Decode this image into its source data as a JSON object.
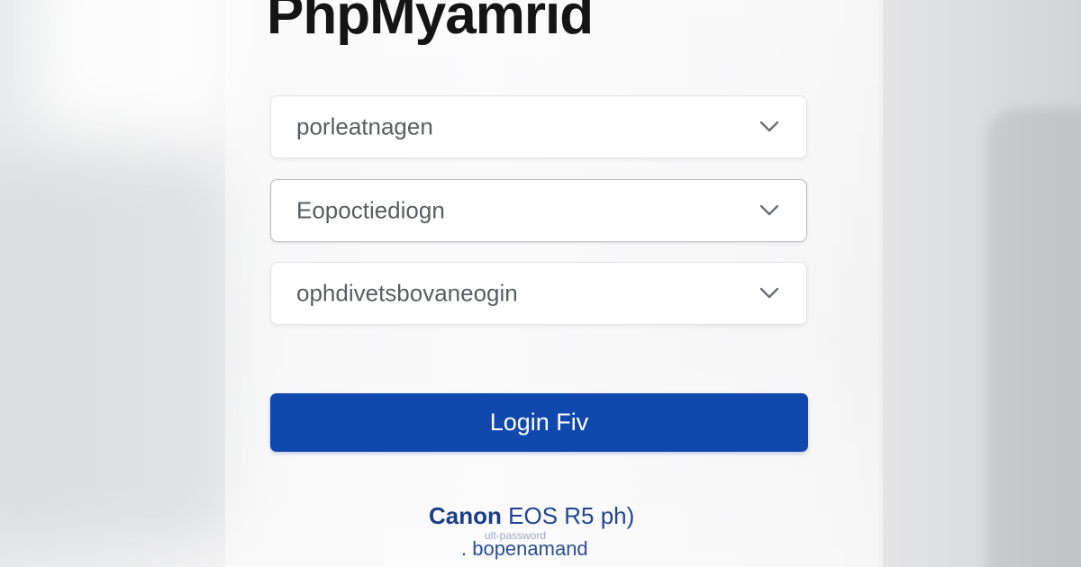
{
  "app": {
    "title": "PhpMyamrid"
  },
  "login_form": {
    "fields": [
      {
        "value": "porleatnagen",
        "icon": "chevron-down-icon"
      },
      {
        "value": "Eopoctiediogn",
        "icon": "chevron-down-icon"
      },
      {
        "value": "ophdivetsbovaneogin",
        "icon": "chevron-down-icon"
      }
    ],
    "submit_label": "Login Fiv"
  },
  "footer": {
    "brand": "Canon",
    "model": "EOS R5  ph)",
    "faint": "ult-password",
    "line2": ". bopenamand"
  },
  "colors": {
    "accent": "#1148ad",
    "title": "#151515",
    "footer_text": "#1a3f86"
  }
}
